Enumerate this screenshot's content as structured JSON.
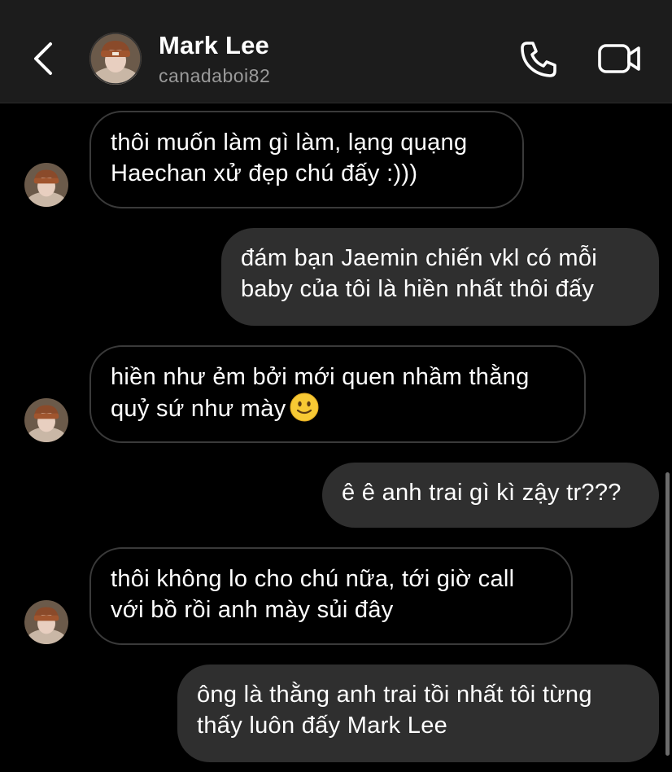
{
  "header": {
    "back_icon": "chevron-left-icon",
    "contact_name": "Mark Lee",
    "contact_username": "canadaboi82",
    "call_icon": "phone-icon",
    "video_icon": "video-camera-icon"
  },
  "messages": [
    {
      "sender": "contact",
      "lines": [
        "thôi muốn làm gì làm, lạng quạng",
        "Haechan xử đẹp chú đấy :)))"
      ]
    },
    {
      "sender": "me",
      "lines": [
        "đám bạn Jaemin chiến vkl có mỗi",
        "baby của tôi là hiền nhất thôi đấy"
      ]
    },
    {
      "sender": "contact",
      "lines": [
        "hiền như ẻm bởi mới quen nhầm thằng",
        "quỷ sứ như mày"
      ],
      "emoji": "slightly-smiling-face-emoji"
    },
    {
      "sender": "me",
      "lines": [
        "ê ê anh trai gì kì zậy tr???"
      ]
    },
    {
      "sender": "contact",
      "lines": [
        "thôi không lo cho chú nữa, tới giờ call",
        "với bồ rồi anh mày sủi đây"
      ]
    },
    {
      "sender": "me",
      "lines": [
        "ông là thằng anh trai tồi nhất tôi từng",
        "thấy luôn đấy Mark Lee"
      ]
    }
  ],
  "colors": {
    "background": "#000000",
    "header_background": "#1c1c1c",
    "outgoing_bubble": "#2f2f2f",
    "incoming_border": "#3a3a3a",
    "username_gray": "#9a9a9a"
  }
}
